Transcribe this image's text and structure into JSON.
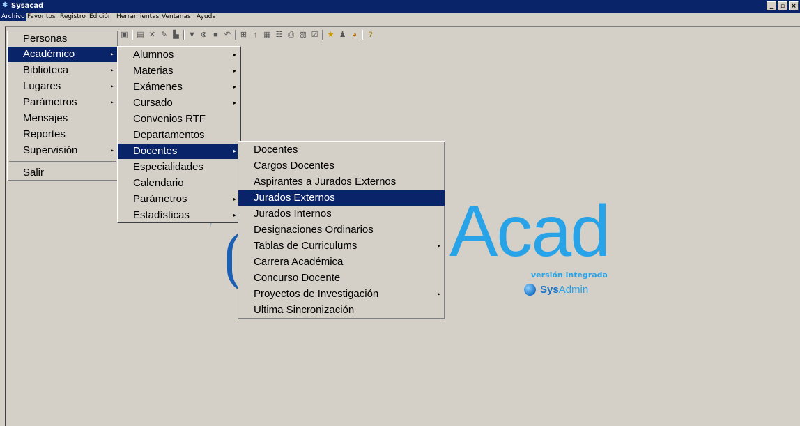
{
  "window": {
    "title": "Sysacad",
    "buttons": [
      "_",
      "▫",
      "×"
    ]
  },
  "menubar": [
    "Archivo",
    "Favoritos",
    "Registro",
    "Edición",
    "Herramientas",
    "Ventanas",
    "Ayuda"
  ],
  "toolbar_icons": [
    "clipboard-icon",
    "doc-icon",
    "delete-icon",
    "edit-icon",
    "chart-icon",
    "filter-icon",
    "cancel-icon",
    "save-icon",
    "back-icon",
    "tree-icon",
    "up-icon",
    "grid-icon",
    "list-icon",
    "print-icon",
    "preview-icon",
    "check-icon",
    "star-icon",
    "users-icon",
    "tools-icon",
    "help-icon"
  ],
  "menu1": {
    "items": [
      {
        "label": "Personas",
        "arrow": false
      },
      {
        "label": "Académico",
        "arrow": true,
        "selected": true
      },
      {
        "label": "Biblioteca",
        "arrow": true
      },
      {
        "label": "Lugares",
        "arrow": true
      },
      {
        "label": "Parámetros",
        "arrow": true
      },
      {
        "label": "Mensajes",
        "arrow": false
      },
      {
        "label": "Reportes",
        "arrow": false
      },
      {
        "label": "Supervisión",
        "arrow": true
      },
      {
        "label": "Salir",
        "arrow": false
      }
    ]
  },
  "menu2": {
    "items": [
      {
        "label": "Alumnos",
        "arrow": true
      },
      {
        "label": "Materias",
        "arrow": true
      },
      {
        "label": "Exámenes",
        "arrow": true
      },
      {
        "label": "Cursado",
        "arrow": true
      },
      {
        "label": "Convenios RTF",
        "arrow": false
      },
      {
        "label": "Departamentos",
        "arrow": false
      },
      {
        "label": "Docentes",
        "arrow": true,
        "selected": true
      },
      {
        "label": "Especialidades",
        "arrow": false
      },
      {
        "label": "Calendario",
        "arrow": false
      },
      {
        "label": "Parámetros",
        "arrow": true
      },
      {
        "label": "Estadísticas",
        "arrow": true
      }
    ]
  },
  "menu3": {
    "items": [
      {
        "label": "Docentes",
        "arrow": false
      },
      {
        "label": "Cargos Docentes",
        "arrow": false
      },
      {
        "label": "Aspirantes a Jurados Externos",
        "arrow": false
      },
      {
        "label": "Jurados Externos",
        "arrow": false,
        "selected": true
      },
      {
        "label": "Jurados Internos",
        "arrow": false
      },
      {
        "label": "Designaciones Ordinarios",
        "arrow": false
      },
      {
        "label": "Tablas de Curriculums",
        "arrow": true
      },
      {
        "label": "Carrera Académica",
        "arrow": false
      },
      {
        "label": "Concurso Docente",
        "arrow": false
      },
      {
        "label": "Proyectos de Investigación",
        "arrow": true
      },
      {
        "label": "Ultima Sincronización",
        "arrow": false
      }
    ]
  },
  "logo": {
    "acad": "Acad",
    "version": "versión integrada",
    "sys": "Sys",
    "admin": "Admin"
  },
  "colors": {
    "selection": "#0a246a",
    "logo": "#29a3e8",
    "face": "#d4d0c8"
  }
}
